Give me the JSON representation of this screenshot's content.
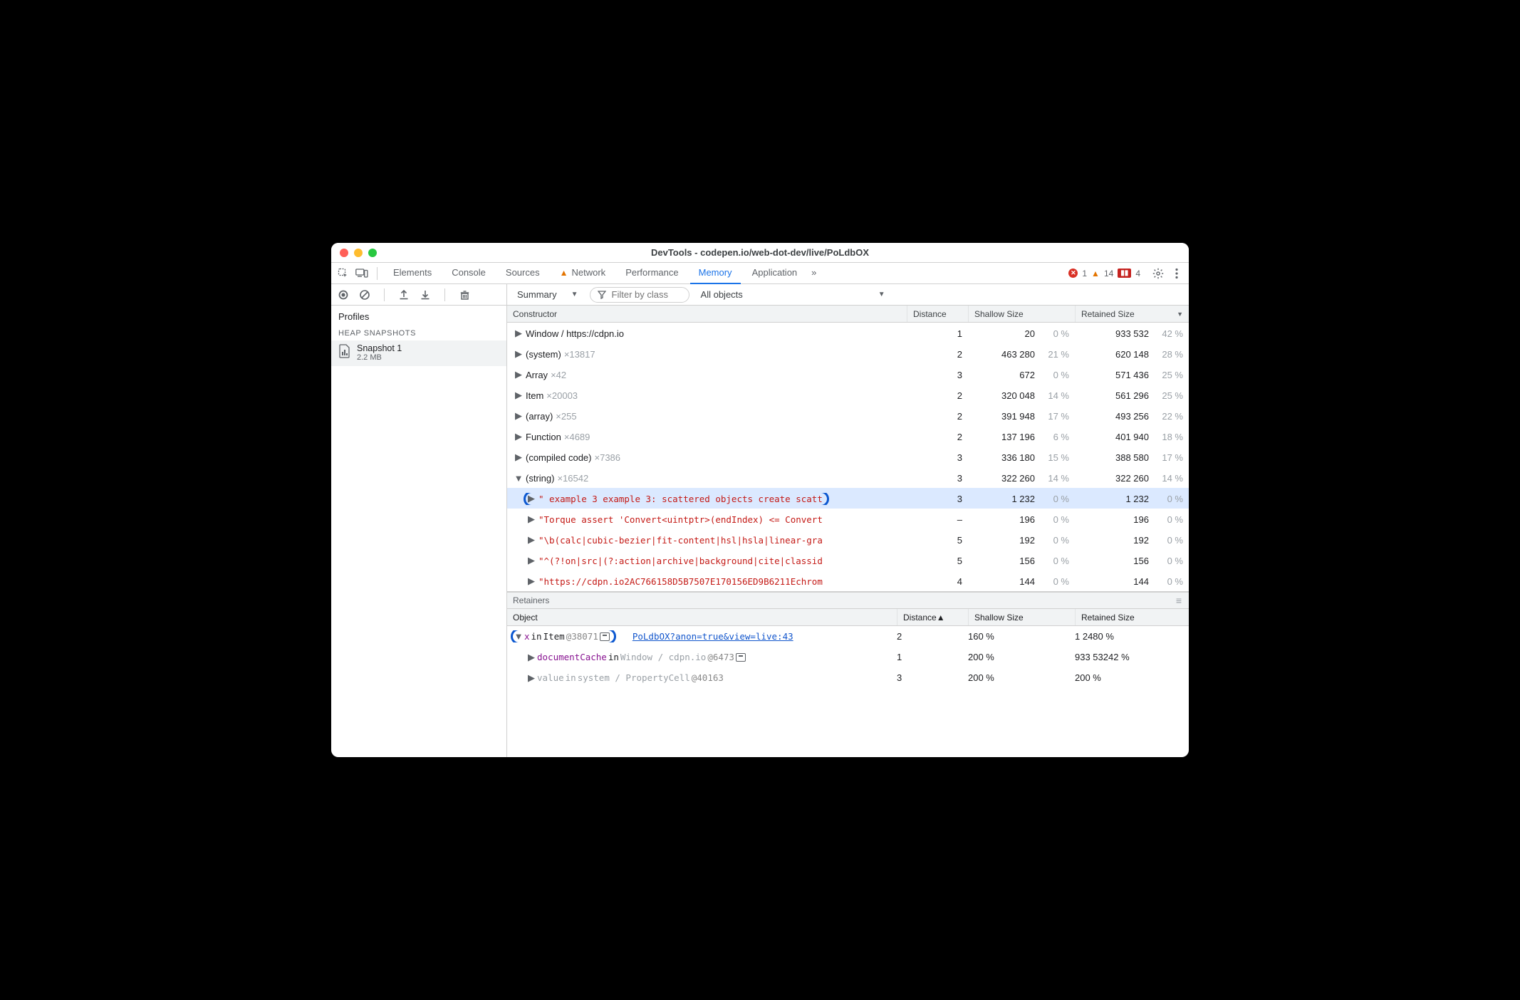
{
  "window": {
    "title": "DevTools - codepen.io/web-dot-dev/live/PoLdbOX"
  },
  "tabs": {
    "items": [
      "Elements",
      "Console",
      "Sources",
      "Network",
      "Performance",
      "Memory",
      "Application"
    ],
    "active": "Memory",
    "network_has_warning": true,
    "more": "»"
  },
  "status": {
    "errors": "1",
    "warnings": "14",
    "coverage": "4"
  },
  "leftPanel": {
    "profiles_label": "Profiles",
    "section_label": "HEAP SNAPSHOTS",
    "snapshot": {
      "name": "Snapshot 1",
      "size": "2.2 MB"
    }
  },
  "toolbar": {
    "summary_label": "Summary",
    "filter_placeholder": "Filter by class",
    "allobjects_label": "All objects"
  },
  "table": {
    "headers": {
      "constructor": "Constructor",
      "distance": "Distance",
      "shallow": "Shallow Size",
      "retained": "Retained Size",
      "sorted_desc": true
    },
    "rows": [
      {
        "indent": 0,
        "expanded": false,
        "label": "Window / https://cdpn.io",
        "count": null,
        "distance": "1",
        "shallow": "20",
        "shallow_pct": "0 %",
        "retained": "933 532",
        "retained_pct": "42 %"
      },
      {
        "indent": 0,
        "expanded": false,
        "label": "(system)",
        "count": "×13817",
        "distance": "2",
        "shallow": "463 280",
        "shallow_pct": "21 %",
        "retained": "620 148",
        "retained_pct": "28 %"
      },
      {
        "indent": 0,
        "expanded": false,
        "label": "Array",
        "count": "×42",
        "distance": "3",
        "shallow": "672",
        "shallow_pct": "0 %",
        "retained": "571 436",
        "retained_pct": "25 %"
      },
      {
        "indent": 0,
        "expanded": false,
        "label": "Item",
        "count": "×20003",
        "distance": "2",
        "shallow": "320 048",
        "shallow_pct": "14 %",
        "retained": "561 296",
        "retained_pct": "25 %"
      },
      {
        "indent": 0,
        "expanded": false,
        "label": "(array)",
        "count": "×255",
        "distance": "2",
        "shallow": "391 948",
        "shallow_pct": "17 %",
        "retained": "493 256",
        "retained_pct": "22 %"
      },
      {
        "indent": 0,
        "expanded": false,
        "label": "Function",
        "count": "×4689",
        "distance": "2",
        "shallow": "137 196",
        "shallow_pct": "6 %",
        "retained": "401 940",
        "retained_pct": "18 %"
      },
      {
        "indent": 0,
        "expanded": false,
        "label": "(compiled code)",
        "count": "×7386",
        "distance": "3",
        "shallow": "336 180",
        "shallow_pct": "15 %",
        "retained": "388 580",
        "retained_pct": "17 %"
      },
      {
        "indent": 0,
        "expanded": true,
        "label": "(string)",
        "count": "×16542",
        "distance": "3",
        "shallow": "322 260",
        "shallow_pct": "14 %",
        "retained": "322 260",
        "retained_pct": "14 %"
      },
      {
        "indent": 1,
        "expanded": false,
        "string": true,
        "selected": true,
        "label": "\" example 3 example 3: scattered objects create scatt",
        "distance": "3",
        "shallow": "1 232",
        "shallow_pct": "0 %",
        "retained": "1 232",
        "retained_pct": "0 %",
        "highlighted": true
      },
      {
        "indent": 1,
        "expanded": false,
        "string": true,
        "label": "\"Torque assert 'Convert<uintptr>(endIndex) <= Convert",
        "distance": "–",
        "shallow": "196",
        "shallow_pct": "0 %",
        "retained": "196",
        "retained_pct": "0 %"
      },
      {
        "indent": 1,
        "expanded": false,
        "string": true,
        "label": "\"\\b(calc|cubic-bezier|fit-content|hsl|hsla|linear-gra",
        "distance": "5",
        "shallow": "192",
        "shallow_pct": "0 %",
        "retained": "192",
        "retained_pct": "0 %"
      },
      {
        "indent": 1,
        "expanded": false,
        "string": true,
        "label": "\"^(?!on|src|(?:action|archive|background|cite|classid",
        "distance": "5",
        "shallow": "156",
        "shallow_pct": "0 %",
        "retained": "156",
        "retained_pct": "0 %"
      },
      {
        "indent": 1,
        "expanded": false,
        "string": true,
        "label": "\"https://cdpn.io2AC766158D5B7507E170156ED9B6211Echrom",
        "distance": "4",
        "shallow": "144",
        "shallow_pct": "0 %",
        "retained": "144",
        "retained_pct": "0 %"
      }
    ]
  },
  "retainers": {
    "title": "Retainers",
    "headers": {
      "object": "Object",
      "distance": "Distance",
      "shallow": "Shallow Size",
      "retained": "Retained Size",
      "sorted_asc": true
    },
    "rows": [
      {
        "indent": 0,
        "expanded": true,
        "selected": true,
        "highlighted": true,
        "prop": "x",
        "in": " in ",
        "klass": "Item",
        "oid": " @38071",
        "popout": true,
        "link": "PoLdbOX?anon=true&view=live:43",
        "distance": "2",
        "shallow": "16",
        "shallow_pct": "0 %",
        "retained": "1 248",
        "retained_pct": "0 %"
      },
      {
        "indent": 1,
        "expanded": false,
        "prop": "documentCache",
        "in": " in ",
        "klass_muted": "Window / cdpn.io",
        "oid": " @6473",
        "popout": true,
        "distance": "1",
        "shallow": "20",
        "shallow_pct": "0 %",
        "retained": "933 532",
        "retained_pct": "42 %"
      },
      {
        "indent": 1,
        "expanded": false,
        "prop_muted": "value",
        "in_muted": " in ",
        "klass_muted": "system / PropertyCell",
        "oid": " @40163",
        "distance": "3",
        "shallow": "20",
        "shallow_pct": "0 %",
        "retained": "20",
        "retained_pct": "0 %"
      }
    ]
  }
}
